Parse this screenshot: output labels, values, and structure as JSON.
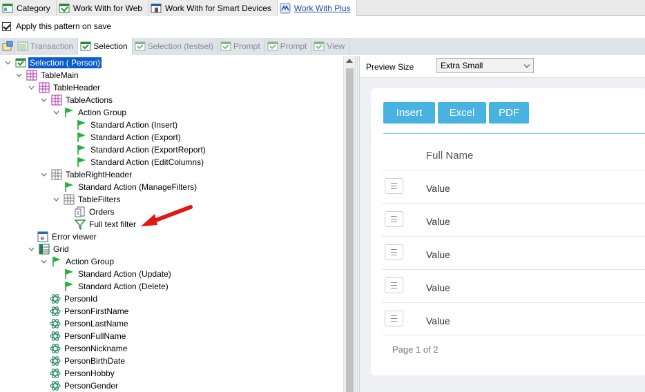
{
  "doc_tabs": [
    {
      "label": "Category",
      "icon": "category-icon",
      "active": false
    },
    {
      "label": "Work With for Web",
      "icon": "workwith-web-icon",
      "active": false
    },
    {
      "label": "Work With for Smart Devices",
      "icon": "workwith-sd-icon",
      "active": false
    },
    {
      "label": "Work With Plus",
      "icon": "workwith-plus-icon",
      "active": true
    }
  ],
  "apply": {
    "label": "Apply this pattern on save",
    "checked": true
  },
  "instance_tabs": [
    {
      "label": "Transaction",
      "active": false
    },
    {
      "label": "Selection",
      "active": true
    },
    {
      "label": "Selection (testsel)",
      "active": false
    },
    {
      "label": "Prompt",
      "active": false
    },
    {
      "label": "Prompt",
      "active": false
    },
    {
      "label": "View",
      "active": false
    }
  ],
  "tree": [
    {
      "label": "Selection ( Person)",
      "icon": "selection-icon",
      "selected": true
    },
    {
      "label": "TableMain",
      "icon": "table-icon"
    },
    {
      "label": "TableHeader",
      "icon": "table-icon"
    },
    {
      "label": "TableActions",
      "icon": "table-icon"
    },
    {
      "label": "Action Group",
      "icon": "flag-icon"
    },
    {
      "label": "Standard Action (Insert)",
      "icon": "flag-icon"
    },
    {
      "label": "Standard Action (Export)",
      "icon": "flag-icon"
    },
    {
      "label": "Standard Action (ExportReport)",
      "icon": "flag-icon"
    },
    {
      "label": "Standard Action (EditColumns)",
      "icon": "flag-icon"
    },
    {
      "label": "TableRightHeader",
      "icon": "grid-table-icon"
    },
    {
      "label": "Standard Action (ManageFilters)",
      "icon": "flag-icon"
    },
    {
      "label": "TableFilters",
      "icon": "grid-table-icon"
    },
    {
      "label": "Orders",
      "icon": "orders-icon"
    },
    {
      "label": "Full text filter",
      "icon": "filter-icon"
    },
    {
      "label": "Error viewer",
      "icon": "error-viewer-icon"
    },
    {
      "label": "Grid",
      "icon": "grid-icon"
    },
    {
      "label": "Action Group",
      "icon": "flag-icon"
    },
    {
      "label": "Standard Action (Update)",
      "icon": "flag-icon"
    },
    {
      "label": "Standard Action (Delete)",
      "icon": "flag-icon"
    },
    {
      "label": "PersonId",
      "icon": "attribute-icon"
    },
    {
      "label": "PersonFirstName",
      "icon": "attribute-icon"
    },
    {
      "label": "PersonLastName",
      "icon": "attribute-icon"
    },
    {
      "label": "PersonFullName",
      "icon": "attribute-icon"
    },
    {
      "label": "PersonNickname",
      "icon": "attribute-icon"
    },
    {
      "label": "PersonBirthDate",
      "icon": "attribute-icon"
    },
    {
      "label": "PersonHobby",
      "icon": "attribute-icon"
    },
    {
      "label": "PersonGender",
      "icon": "attribute-icon"
    }
  ],
  "preview": {
    "size_label": "Preview Size",
    "size_value": "Extra Small",
    "buttons": [
      "Insert",
      "Excel",
      "PDF"
    ],
    "column_header": "Full Name",
    "rows": [
      "Value",
      "Value",
      "Value",
      "Value",
      "Value"
    ],
    "pager": "Page 1 of 2",
    "accent": "#48b3e0"
  }
}
